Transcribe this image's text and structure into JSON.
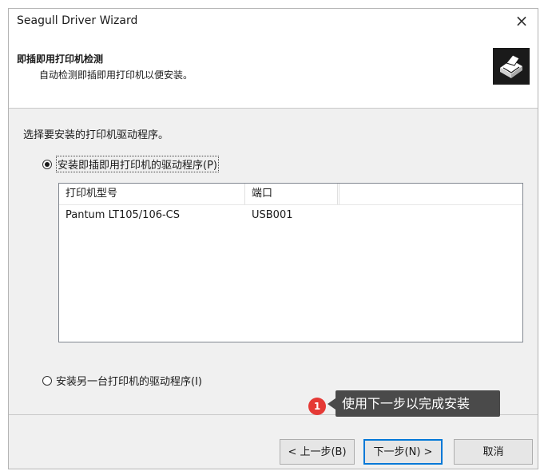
{
  "window": {
    "title": "Seagull Driver Wizard",
    "close_glyph": "×"
  },
  "header": {
    "title": "即插即用打印机检测",
    "subtitle": "自动检测即插即用打印机以便安装。",
    "icon": "printer-icon"
  },
  "main": {
    "prompt": "选择要安装的打印机驱动程序。",
    "options": [
      {
        "label": "安装即插即用打印机的驱动程序(P)",
        "selected": true
      },
      {
        "label": "安装另一台打印机的驱动程序(I)",
        "selected": false
      }
    ],
    "list": {
      "columns": [
        "打印机型号",
        "端口",
        ""
      ],
      "rows": [
        {
          "model": "Pantum LT105/106-CS",
          "port": "USB001"
        }
      ]
    }
  },
  "footer": {
    "back_label": "< 上一步(B)",
    "next_label": "下一步(N) >",
    "cancel_label": "取消"
  },
  "annotation": {
    "badge": "1",
    "text": "使用下一步以完成安装",
    "color": "#e53935"
  }
}
